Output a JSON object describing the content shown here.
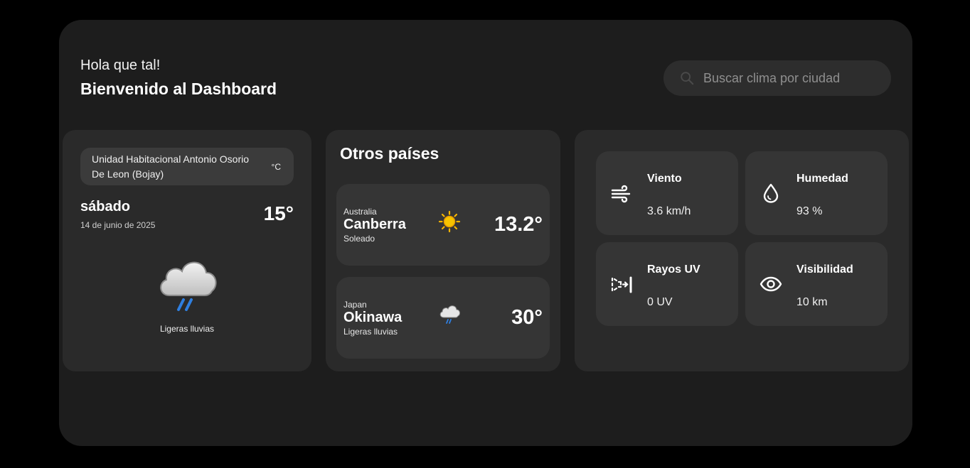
{
  "header": {
    "greeting": "Hola que tal!",
    "welcome": "Bienvenido al Dashboard"
  },
  "search": {
    "placeholder": "Buscar clima por ciudad",
    "icon": "search-icon"
  },
  "current": {
    "location": "Unidad Habitacional Antonio Osorio De Leon (Bojay)",
    "unit": "°C",
    "day": "sábado",
    "date": "14 de junio de 2025",
    "temperature": "15°",
    "condition": "Ligeras lluvias",
    "icon": "rain-cloud-icon"
  },
  "others": {
    "title": "Otros países",
    "cities": [
      {
        "country": "Australia",
        "city": "Canberra",
        "condition": "Soleado",
        "temperature": "13.2°",
        "icon": "sun-icon"
      },
      {
        "country": "Japan",
        "city": "Okinawa",
        "condition": "Ligeras lluvias",
        "temperature": "30°",
        "icon": "rain-cloud-icon"
      }
    ]
  },
  "highlights": [
    {
      "label": "Viento",
      "value": "3.6 km/h",
      "icon": "wind-icon"
    },
    {
      "label": "Humedad",
      "value": "93 %",
      "icon": "droplet-icon"
    },
    {
      "label": "Rayos UV",
      "value": "0 UV",
      "icon": "uv-icon"
    },
    {
      "label": "Visibilidad",
      "value": "10 km",
      "icon": "eye-icon"
    }
  ],
  "colors": {
    "page_bg": "#000000",
    "panel_bg": "#1d1d1d",
    "card_bg": "#2a2a2a",
    "inner_card_bg": "#353535",
    "rain_accent": "#2f7fe0",
    "sun_accent": "#f7b500"
  }
}
